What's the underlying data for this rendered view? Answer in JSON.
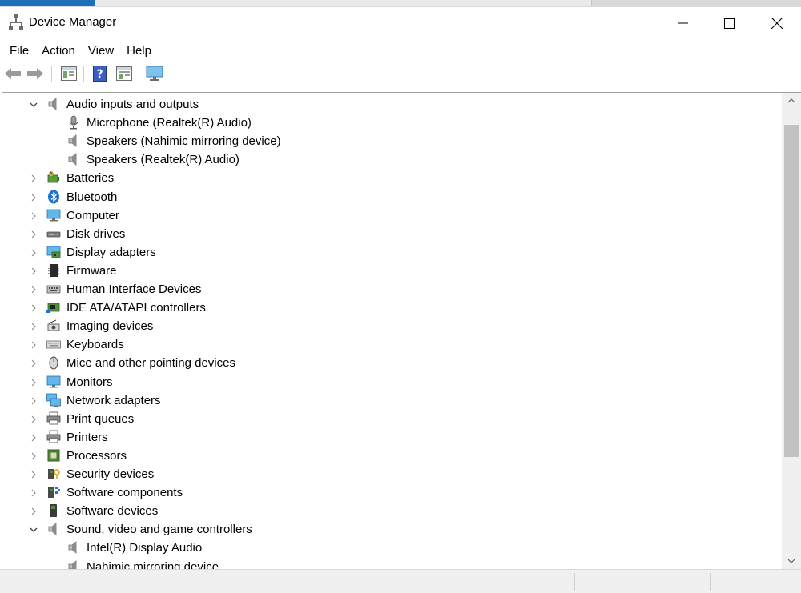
{
  "window": {
    "title": "Device Manager",
    "controls": {
      "minimize": "minimize",
      "maximize": "maximize",
      "close": "close"
    }
  },
  "menu": [
    "File",
    "Action",
    "View",
    "Help"
  ],
  "toolbar": {
    "icons": [
      "back-arrow-icon",
      "forward-arrow-icon",
      "properties-icon",
      "help-icon",
      "update-driver-icon",
      "scan-hardware-icon"
    ]
  },
  "tree": [
    {
      "label": "Audio inputs and outputs",
      "expanded": true,
      "level": 0,
      "icon": "speaker-icon"
    },
    {
      "label": "Microphone (Realtek(R) Audio)",
      "level": 1,
      "icon": "microphone-icon"
    },
    {
      "label": "Speakers (Nahimic mirroring device)",
      "level": 1,
      "icon": "speaker-icon"
    },
    {
      "label": "Speakers (Realtek(R) Audio)",
      "level": 1,
      "icon": "speaker-icon"
    },
    {
      "label": "Batteries",
      "expanded": false,
      "level": 0,
      "icon": "battery-icon"
    },
    {
      "label": "Bluetooth",
      "expanded": false,
      "level": 0,
      "icon": "bluetooth-icon"
    },
    {
      "label": "Computer",
      "expanded": false,
      "level": 0,
      "icon": "computer-icon"
    },
    {
      "label": "Disk drives",
      "expanded": false,
      "level": 0,
      "icon": "disk-drive-icon"
    },
    {
      "label": "Display adapters",
      "expanded": false,
      "level": 0,
      "icon": "display-adapter-icon"
    },
    {
      "label": "Firmware",
      "expanded": false,
      "level": 0,
      "icon": "firmware-icon"
    },
    {
      "label": "Human Interface Devices",
      "expanded": false,
      "level": 0,
      "icon": "hid-icon"
    },
    {
      "label": "IDE ATA/ATAPI controllers",
      "expanded": false,
      "level": 0,
      "icon": "ide-controller-icon"
    },
    {
      "label": "Imaging devices",
      "expanded": false,
      "level": 0,
      "icon": "camera-icon"
    },
    {
      "label": "Keyboards",
      "expanded": false,
      "level": 0,
      "icon": "keyboard-icon"
    },
    {
      "label": "Mice and other pointing devices",
      "expanded": false,
      "level": 0,
      "icon": "mouse-icon"
    },
    {
      "label": "Monitors",
      "expanded": false,
      "level": 0,
      "icon": "monitor-icon"
    },
    {
      "label": "Network adapters",
      "expanded": false,
      "level": 0,
      "icon": "network-adapter-icon"
    },
    {
      "label": "Print queues",
      "expanded": false,
      "level": 0,
      "icon": "printer-icon"
    },
    {
      "label": "Printers",
      "expanded": false,
      "level": 0,
      "icon": "printer-icon"
    },
    {
      "label": "Processors",
      "expanded": false,
      "level": 0,
      "icon": "processor-icon"
    },
    {
      "label": "Security devices",
      "expanded": false,
      "level": 0,
      "icon": "security-device-icon"
    },
    {
      "label": "Software components",
      "expanded": false,
      "level": 0,
      "icon": "software-component-icon"
    },
    {
      "label": "Software devices",
      "expanded": false,
      "level": 0,
      "icon": "software-device-icon"
    },
    {
      "label": "Sound, video and game controllers",
      "expanded": true,
      "level": 0,
      "icon": "speaker-icon"
    },
    {
      "label": "Intel(R) Display Audio",
      "level": 1,
      "icon": "speaker-icon"
    },
    {
      "label": "Nahimic mirroring device",
      "level": 1,
      "icon": "speaker-icon"
    }
  ],
  "colors": {
    "accent": "#1d6fb8",
    "selection": "#cce8ff"
  }
}
